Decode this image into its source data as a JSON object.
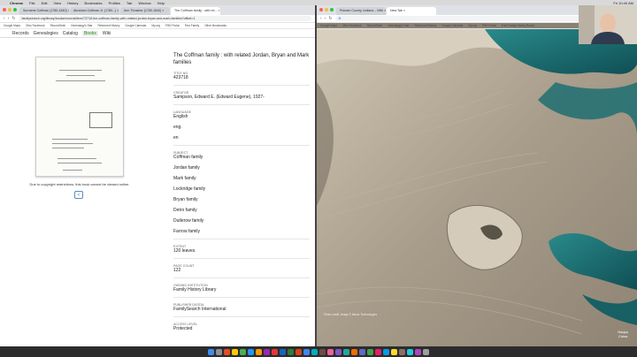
{
  "menubar": {
    "app": "Chrome",
    "items": [
      "File",
      "Edit",
      "View",
      "History",
      "Bookmarks",
      "Profiles",
      "Tab",
      "Window",
      "Help"
    ],
    "clock": "Fri 10:40 AM"
  },
  "left_browser": {
    "tabs": [
      "Surname Coffman (1780-1840) ×",
      "Abraham Coffman Jr. (1780...) ×",
      "Ann Thrasher (1780-1840) ×",
      "The Coffman family : with rel... ×"
    ],
    "url": "familysearch.org/library/books/records/item/73718-the-coffman-family-with-related-jordan-bryan-and-mark-families?offset=1",
    "bookmarks": [
      "Google Maps",
      "Ohio Facebook",
      "RecordSeek",
      "Genealogy's Star",
      "Reformed History",
      "Google Calendar",
      "My.org",
      "FHD Portal",
      "Find Family",
      "Other Bookmarks"
    ],
    "nav": [
      "Records",
      "Genealogies",
      "Catalog",
      "Books",
      "Wiki"
    ],
    "nav_active": "Books",
    "copyright_notice": "Due to copyright restrictions, this book cannot be viewed online.",
    "book": {
      "title": "The Coffman family : with related Jordan, Bryan and Mark families",
      "title_no_label": "TITLE NO",
      "title_no": "423718",
      "creator_label": "CREATOR",
      "creator": "Sampson, Edward E. (Edward Eugene), 1927-",
      "language_label": "LANGUAGE",
      "languages": [
        "English",
        "eng.",
        "en"
      ],
      "subject_label": "SUBJECT",
      "subjects": [
        "Coffman family",
        "Jordan family",
        "Mark family",
        "Lockridge family",
        "Bryan family",
        "Detro family",
        "Dutlerow family",
        "Farrow family"
      ],
      "extent_label": "EXTENT",
      "extent": "120 leaves.",
      "page_count_label": "PAGE COUNT",
      "page_count": "122",
      "owning_label": "OWNING INSTITUTION",
      "owning": "Family History Library",
      "publisher_label": "PUBLISHER DIGITAL",
      "publisher": "FamilySearch International",
      "access_label": "ACCESS LEVEL",
      "access": "Protected"
    }
  },
  "right_browser": {
    "tabs": [
      "Putnam County, Indiana – Wiki ×",
      "New Tab ×"
    ],
    "bookmarks": [
      "Google Maps",
      "Ohio Facebook",
      "RecordSeek",
      "Genealogy's Star",
      "Reformed History",
      "Google Calendar",
      "My.org",
      "FHD Portal",
      "Free Family History Books"
    ],
    "credit": "Photo credit: Image © Maxar Technologies",
    "corner_top": "Naqqu",
    "corner_bottom": "China"
  },
  "colors": {
    "familysearch_green": "#2b7a2b",
    "desert": "#a89c8a",
    "lake": "#1f6e72"
  }
}
